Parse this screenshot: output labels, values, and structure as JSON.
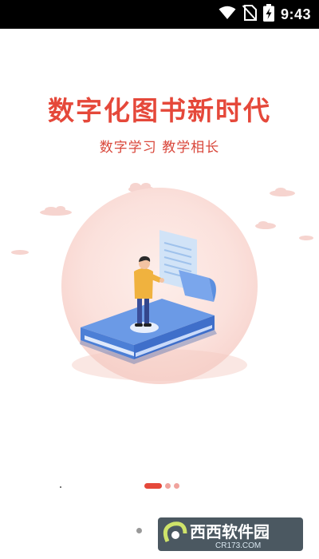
{
  "status_bar": {
    "time": "9:43",
    "icons": [
      "wifi-icon",
      "no-sim-icon",
      "battery-charging-icon"
    ]
  },
  "splash": {
    "title": "数字化图书新时代",
    "subtitle": "数字学习 教学相长"
  },
  "pager": {
    "page_count": 3,
    "active_index": 0
  },
  "watermark": {
    "brand": "西西软件园",
    "url": "CR173.COM"
  },
  "colors": {
    "accent": "#e5483a",
    "status_bar": "#000000",
    "book_blue": "#5b8fe0",
    "halo_pink": "#fbe3df"
  }
}
